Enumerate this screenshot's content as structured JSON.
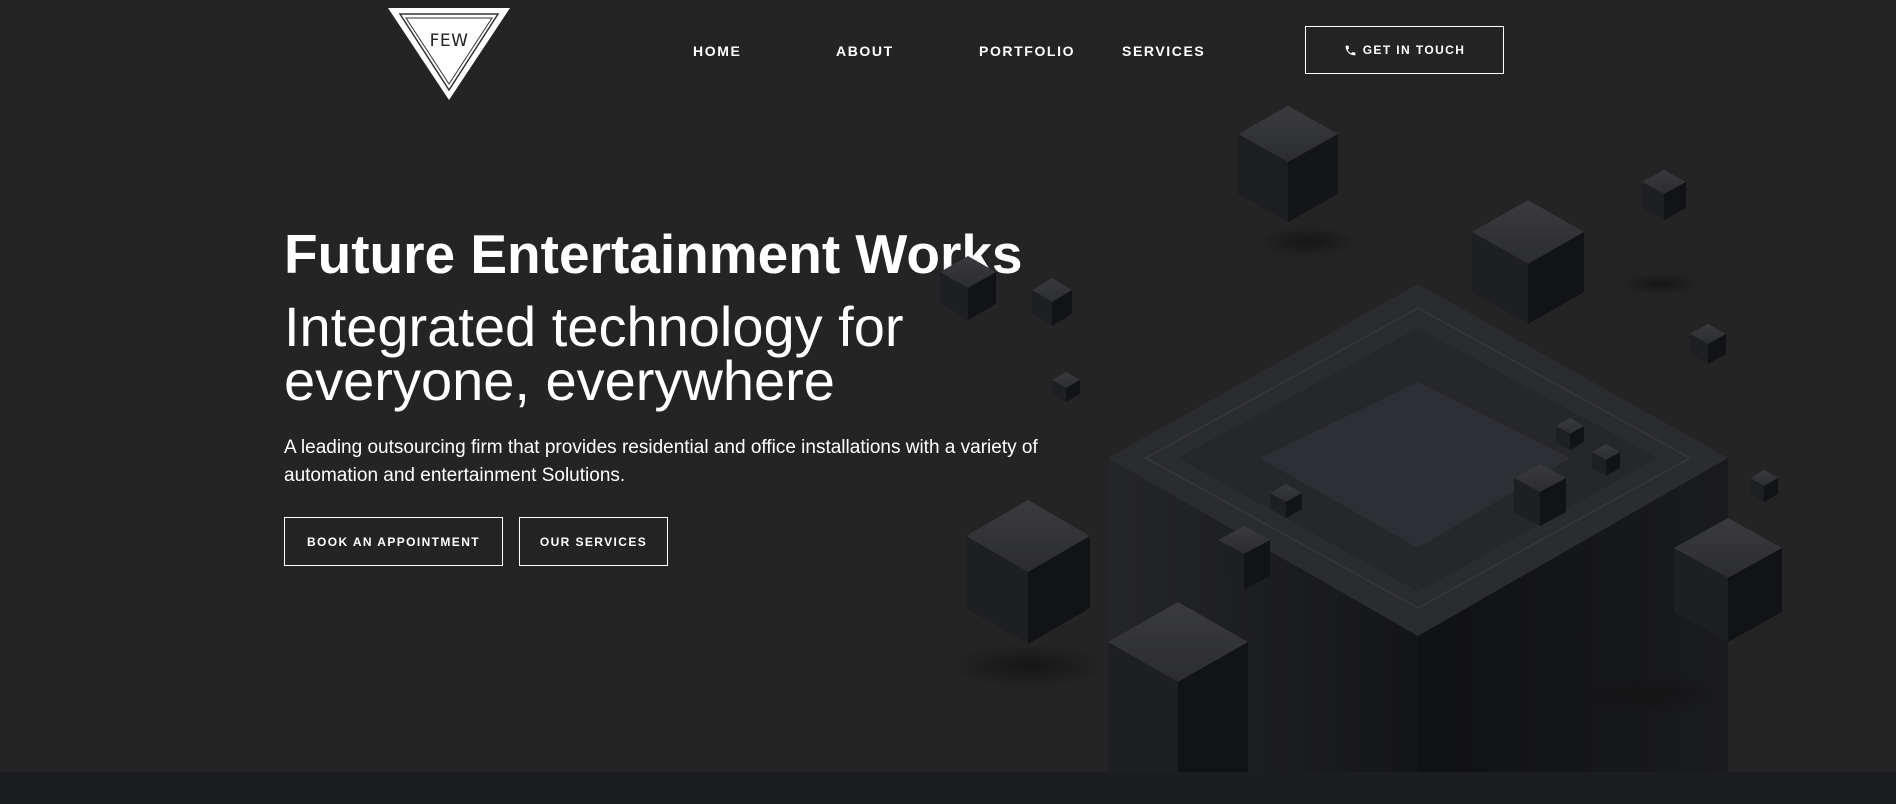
{
  "brand": {
    "logo_text": "FEW"
  },
  "nav": {
    "items": [
      {
        "label": "HOME"
      },
      {
        "label": "ABOUT"
      },
      {
        "label": "PORTFOLIO"
      },
      {
        "label": "SERVICES"
      }
    ],
    "cta_label": "GET IN TOUCH",
    "cta_icon": "phone-icon"
  },
  "hero": {
    "title": "Future Entertainment Works",
    "subtitle": "Integrated technology for everyone, everywhere",
    "description": "A leading outsourcing firm that provides residential and office installations with a variety of automation and entertainment Solutions.",
    "primary_button": "BOOK AN APPOINTMENT",
    "secondary_button": "OUR SERVICES"
  },
  "colors": {
    "background": "#242424",
    "bottom_band": "#1c1d21",
    "text": "#ffffff"
  }
}
